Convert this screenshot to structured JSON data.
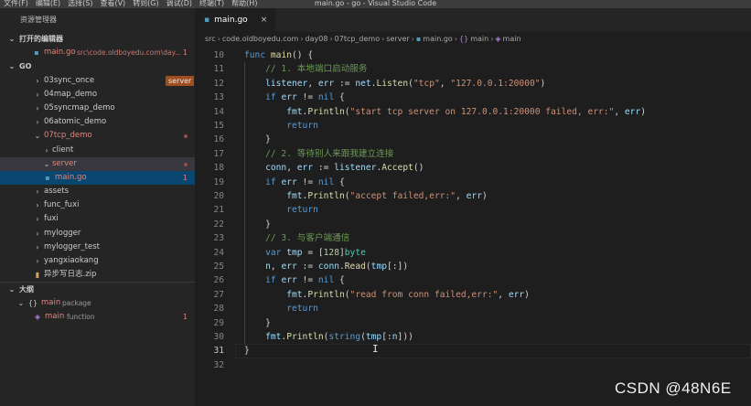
{
  "menubar": {
    "items": [
      "文件(F)",
      "编辑(E)",
      "选择(S)",
      "查看(V)",
      "转到(G)",
      "调试(D)",
      "终端(T)",
      "帮助(H)"
    ],
    "window_title": "main.go - go - Visual Studio Code"
  },
  "sidebar": {
    "title": "资源管理器",
    "open_editors": {
      "header": "打开的编辑器",
      "file": "main.go",
      "path": "src\\code.oldboyedu.com\\day...",
      "count": "1"
    },
    "workspace": {
      "header": "GO",
      "items": [
        {
          "label": "03sync_once",
          "badge": "server"
        },
        {
          "label": "04map_demo"
        },
        {
          "label": "05syncmap_demo"
        },
        {
          "label": "06atomic_demo"
        },
        {
          "label": "07tcp_demo"
        },
        {
          "label": "client"
        },
        {
          "label": "server"
        },
        {
          "label": "main.go",
          "count": "1"
        },
        {
          "label": "assets"
        },
        {
          "label": "func_fuxi"
        },
        {
          "label": "fuxi"
        },
        {
          "label": "mylogger"
        },
        {
          "label": "mylogger_test"
        },
        {
          "label": "yangxiaokang"
        },
        {
          "label": "异步写日志.zip"
        }
      ]
    },
    "outline": {
      "header": "大纲",
      "items": [
        {
          "label": "main",
          "detail": "package"
        },
        {
          "label": "main",
          "detail": "function",
          "count": "1"
        }
      ]
    }
  },
  "tab": {
    "label": "main.go",
    "close": "×"
  },
  "breadcrumb": {
    "parts": [
      "src",
      "code.oldboyedu.com",
      "day08",
      "07tcp_demo",
      "server",
      "main.go",
      "main",
      "main"
    ]
  },
  "editor": {
    "lines": [
      {
        "n": "10",
        "text": "func main() {"
      },
      {
        "n": "11",
        "text": "    // 1. 本地端口启动服务"
      },
      {
        "n": "12",
        "text": "    listener, err := net.Listen(\"tcp\", \"127.0.0.1:20000\")"
      },
      {
        "n": "13",
        "text": "    if err != nil {"
      },
      {
        "n": "14",
        "text": "        fmt.Println(\"start tcp server on 127.0.0.1:20000 failed, err:\", err)"
      },
      {
        "n": "15",
        "text": "        return"
      },
      {
        "n": "16",
        "text": "    }"
      },
      {
        "n": "17",
        "text": "    // 2. 等待别人来跟我建立连接"
      },
      {
        "n": "18",
        "text": "    conn, err := listener.Accept()"
      },
      {
        "n": "19",
        "text": "    if err != nil {"
      },
      {
        "n": "20",
        "text": "        fmt.Println(\"accept failed,err:\", err)"
      },
      {
        "n": "21",
        "text": "        return"
      },
      {
        "n": "22",
        "text": "    }"
      },
      {
        "n": "23",
        "text": "    // 3. 与客户端通信"
      },
      {
        "n": "24",
        "text": "    var tmp = [128]byte"
      },
      {
        "n": "25",
        "text": "    n, err := conn.Read(tmp[:])"
      },
      {
        "n": "26",
        "text": "    if err != nil {"
      },
      {
        "n": "27",
        "text": "        fmt.Println(\"read from conn failed,err:\", err)"
      },
      {
        "n": "28",
        "text": "        return"
      },
      {
        "n": "29",
        "text": "    }"
      },
      {
        "n": "30",
        "text": "    fmt.Println(string(tmp[:n]))"
      },
      {
        "n": "31",
        "text": "}"
      },
      {
        "n": "32",
        "text": ""
      }
    ],
    "current_line": "31"
  },
  "watermark": "CSDN @48N6E",
  "colors": {
    "keyword": "#569cd6",
    "function": "#dcdcaa",
    "string": "#ce9178",
    "number": "#b5cea8",
    "comment": "#6a9955",
    "type": "#4ec9b0",
    "modified": "#e2867e",
    "badge": "#a04e20"
  },
  "icons": {
    "go_file": "go-file-icon",
    "package": "package-braces-icon",
    "function": "function-cube-icon",
    "chevron_right": "chevron-right-icon",
    "chevron_down": "chevron-down-icon",
    "close": "close-icon",
    "zip": "zip-file-icon"
  }
}
